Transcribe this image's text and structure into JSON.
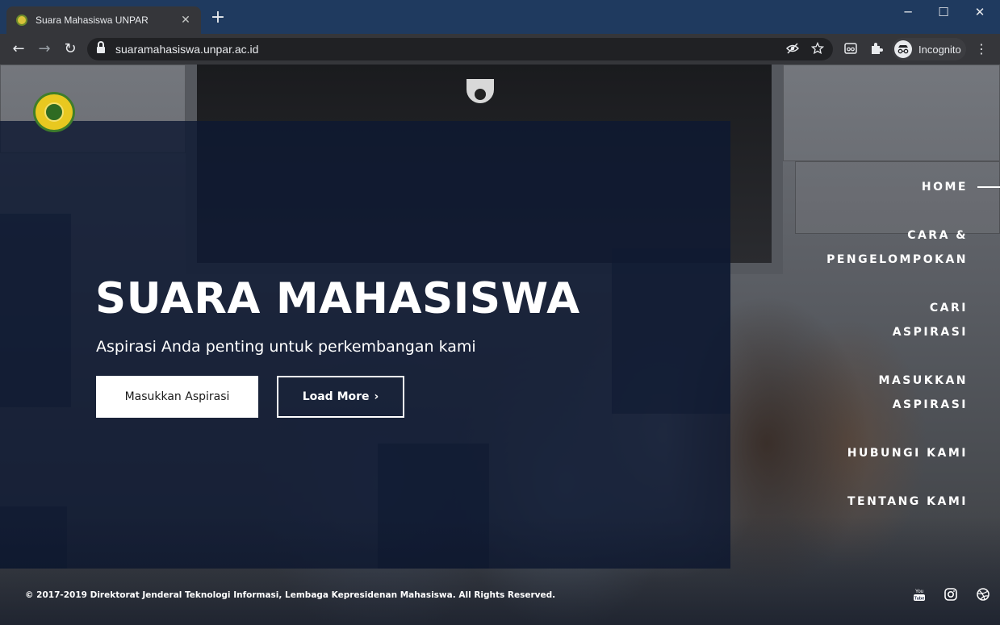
{
  "browser": {
    "tab_title": "Suara Mahasiswa UNPAR",
    "tab_close": "✕",
    "new_tab": "+",
    "url": "suaramahasiswa.unpar.ac.id",
    "incognito_label": "Incognito",
    "window_controls": {
      "minimize": "─",
      "maximize": "☐",
      "close": "✕"
    },
    "nav": {
      "back": "←",
      "forward": "→",
      "reload": "↻"
    },
    "menu": "⋮"
  },
  "hero": {
    "title": "SUARA MAHASISWA",
    "subtitle": "Aspirasi Anda penting untuk perkembangan kami",
    "primary_button": "Masukkan Aspirasi",
    "secondary_button": "Load More",
    "secondary_chevron": "›"
  },
  "nav": {
    "items": [
      {
        "label": "HOME",
        "active": true
      },
      {
        "label_line1": "CARA &",
        "label_line2": "PENGELOMPOKAN"
      },
      {
        "label_line1": "CARI",
        "label_line2": "ASPIRASI"
      },
      {
        "label_line1": "MASUKKAN",
        "label_line2": "ASPIRASI"
      },
      {
        "label": "HUBUNGI KAMI"
      },
      {
        "label": "TENTANG KAMI"
      }
    ]
  },
  "footer": {
    "copyright": "© 2017-2019 Direktorat Jenderal Teknologi Informasi, Lembaga Kepresidenan Mahasiswa. All Rights Reserved.",
    "social_icons": [
      "youtube-icon",
      "instagram-icon",
      "dribbble-icon"
    ],
    "youtube_label": "You Tube"
  },
  "colors": {
    "overlay": "#0e1932",
    "titlebar": "#1f3a5f",
    "toolbar": "#35363a"
  }
}
